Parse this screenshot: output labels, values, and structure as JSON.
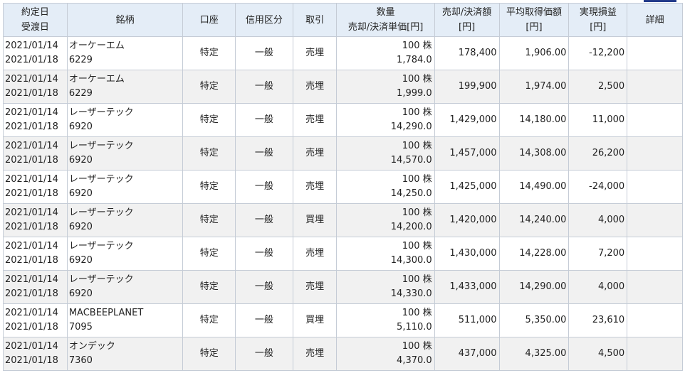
{
  "headers": {
    "date1": "約定日",
    "date2": "受渡日",
    "name": "銘柄",
    "account": "口座",
    "margin": "信用区分",
    "trade": "取引",
    "qty1": "数量",
    "qty2": "売却/決済単価[円]",
    "amount1": "売却/決済額",
    "amount2": "[円]",
    "avg1": "平均取得価額",
    "avg2": "[円]",
    "pl1": "実現損益",
    "pl2": "[円]",
    "detail": "詳細"
  },
  "rows": [
    {
      "trade_date": "2021/01/14",
      "settle_date": "2021/01/18",
      "name": "オーケーエム",
      "code": "6229",
      "account": "特定",
      "margin": "一般",
      "trade": "売埋",
      "qty": "100 株",
      "price": "1,784.0",
      "amount": "178,400",
      "avg": "1,906.00",
      "pl": "-12,200"
    },
    {
      "trade_date": "2021/01/14",
      "settle_date": "2021/01/18",
      "name": "オーケーエム",
      "code": "6229",
      "account": "特定",
      "margin": "一般",
      "trade": "売埋",
      "qty": "100 株",
      "price": "1,999.0",
      "amount": "199,900",
      "avg": "1,974.00",
      "pl": "2,500"
    },
    {
      "trade_date": "2021/01/14",
      "settle_date": "2021/01/18",
      "name": "レーザーテック",
      "code": "6920",
      "account": "特定",
      "margin": "一般",
      "trade": "売埋",
      "qty": "100 株",
      "price": "14,290.0",
      "amount": "1,429,000",
      "avg": "14,180.00",
      "pl": "11,000"
    },
    {
      "trade_date": "2021/01/14",
      "settle_date": "2021/01/18",
      "name": "レーザーテック",
      "code": "6920",
      "account": "特定",
      "margin": "一般",
      "trade": "売埋",
      "qty": "100 株",
      "price": "14,570.0",
      "amount": "1,457,000",
      "avg": "14,308.00",
      "pl": "26,200"
    },
    {
      "trade_date": "2021/01/14",
      "settle_date": "2021/01/18",
      "name": "レーザーテック",
      "code": "6920",
      "account": "特定",
      "margin": "一般",
      "trade": "売埋",
      "qty": "100 株",
      "price": "14,250.0",
      "amount": "1,425,000",
      "avg": "14,490.00",
      "pl": "-24,000"
    },
    {
      "trade_date": "2021/01/14",
      "settle_date": "2021/01/18",
      "name": "レーザーテック",
      "code": "6920",
      "account": "特定",
      "margin": "一般",
      "trade": "買埋",
      "qty": "100 株",
      "price": "14,200.0",
      "amount": "1,420,000",
      "avg": "14,240.00",
      "pl": "4,000"
    },
    {
      "trade_date": "2021/01/14",
      "settle_date": "2021/01/18",
      "name": "レーザーテック",
      "code": "6920",
      "account": "特定",
      "margin": "一般",
      "trade": "売埋",
      "qty": "100 株",
      "price": "14,300.0",
      "amount": "1,430,000",
      "avg": "14,228.00",
      "pl": "7,200"
    },
    {
      "trade_date": "2021/01/14",
      "settle_date": "2021/01/18",
      "name": "レーザーテック",
      "code": "6920",
      "account": "特定",
      "margin": "一般",
      "trade": "売埋",
      "qty": "100 株",
      "price": "14,330.0",
      "amount": "1,433,000",
      "avg": "14,290.00",
      "pl": "4,000"
    },
    {
      "trade_date": "2021/01/14",
      "settle_date": "2021/01/18",
      "name": "MACBEEPLANET",
      "code": "7095",
      "account": "特定",
      "margin": "一般",
      "trade": "買埋",
      "qty": "100 株",
      "price": "5,110.0",
      "amount": "511,000",
      "avg": "5,350.00",
      "pl": "23,610"
    },
    {
      "trade_date": "2021/01/14",
      "settle_date": "2021/01/18",
      "name": "オンデック",
      "code": "7360",
      "account": "特定",
      "margin": "一般",
      "trade": "売埋",
      "qty": "100 株",
      "price": "4,370.0",
      "amount": "437,000",
      "avg": "4,325.00",
      "pl": "4,500"
    }
  ]
}
